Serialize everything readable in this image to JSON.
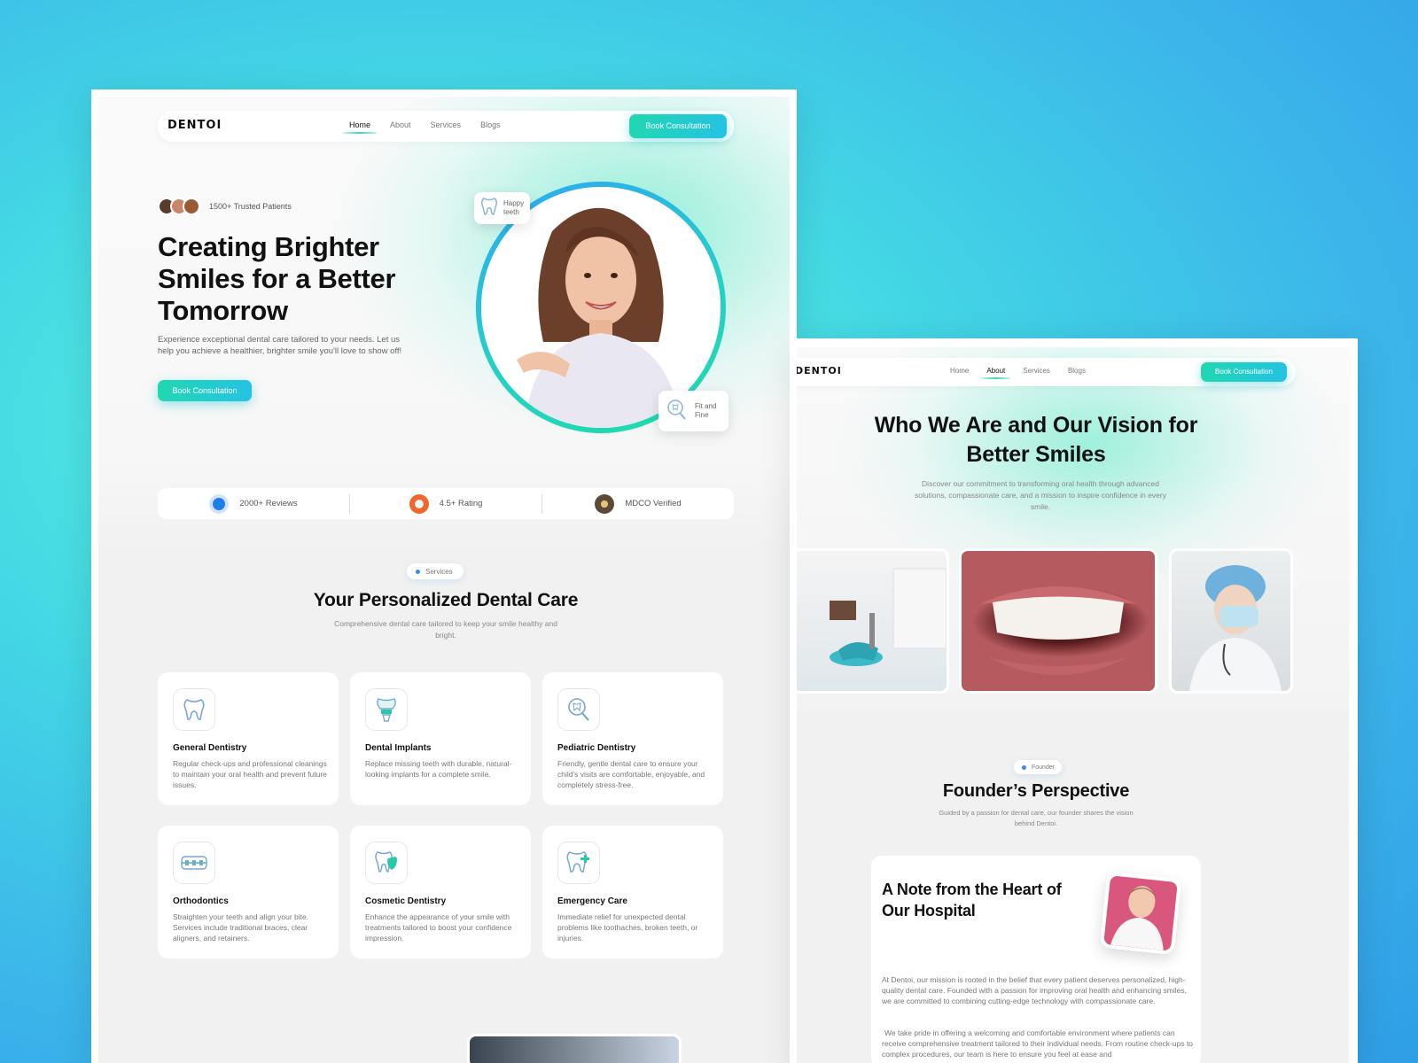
{
  "colors": {
    "accent_start": "#21d7b0",
    "accent_end": "#25c2e4",
    "text": "#111111",
    "muted": "#777777"
  },
  "home": {
    "nav": {
      "logo": "DENTOI",
      "links": [
        "Home",
        "About",
        "Services",
        "Blogs"
      ],
      "active": "Home",
      "cta": "Book Consultation"
    },
    "trusted": "1500+ Trusted Patients",
    "title": "Creating Brighter Smiles for a Better Tomorrow",
    "description": "Experience exceptional dental care tailored to your needs. Let us help you achieve a healthier, brighter smile you'll love to show off!",
    "cta": "Book Consultation",
    "chip_happy": "Happy teeth",
    "chip_fit": "Fit and Fine",
    "stats": [
      {
        "label": "2000+ Reviews",
        "icon": "reviews-badge-icon"
      },
      {
        "label": "4.5+ Rating",
        "icon": "rating-badge-icon"
      },
      {
        "label": "MDCO Verified",
        "icon": "verified-badge-icon"
      }
    ],
    "services": {
      "pill": "Services",
      "title": "Your Personalized Dental Care",
      "subtitle": "Comprehensive dental care tailored to keep your smile healthy and bright.",
      "cards": [
        {
          "title": "General Dentistry",
          "desc": "Regular check-ups and professional cleanings to maintain your oral health and prevent future issues.",
          "icon": "tooth-icon"
        },
        {
          "title": "Dental Implants",
          "desc": "Replace missing teeth with durable, natural-looking implants for a complete smile.",
          "icon": "implant-icon"
        },
        {
          "title": "Pediatric Dentistry",
          "desc": "Friendly, gentle dental care to ensure your child's visits are comfortable, enjoyable, and completely stress-free.",
          "icon": "magnify-tooth-icon"
        },
        {
          "title": "Orthodontics",
          "desc": "Straighten your teeth and align your bite. Services include traditional braces, clear aligners, and retainers.",
          "icon": "braces-icon"
        },
        {
          "title": "Cosmetic Dentistry",
          "desc": "Enhance the appearance of your smile with treatments tailored to boost your confidence impression.",
          "icon": "shield-tooth-icon"
        },
        {
          "title": "Emergency Care",
          "desc": "Immediate relief for unexpected dental problems like toothaches, broken teeth, or injuries.",
          "icon": "emergency-tooth-icon"
        }
      ]
    }
  },
  "about": {
    "nav": {
      "logo": "DENTOI",
      "links": [
        "Home",
        "About",
        "Services",
        "Blogs"
      ],
      "active": "About",
      "cta": "Book Consultation"
    },
    "title": "Who We Are and Our Vision for Better Smiles",
    "subtitle": "Discover our commitment to transforming oral health through advanced solutions, compassionate care, and a mission to inspire confidence in every smile.",
    "founder": {
      "pill": "Founder",
      "title": "Founder’s Perspective",
      "subtitle": "Guided by a passion for dental care, our founder shares the vision behind Dentoi.",
      "note_title": "A Note from the Heart of Our Hospital",
      "p1": "At Dentoi, our mission is rooted in the belief that every patient deserves personalized, high-quality dental care. Founded with a passion for improving oral health and enhancing smiles, we are committed to combining cutting-edge technology with compassionate care.",
      "p2": "We take pride in offering a welcoming and comfortable environment where patients can receive comprehensive treatment tailored to their individual needs. From routine check-ups to complex procedures, our team is here to ensure you feel at ease and"
    }
  }
}
